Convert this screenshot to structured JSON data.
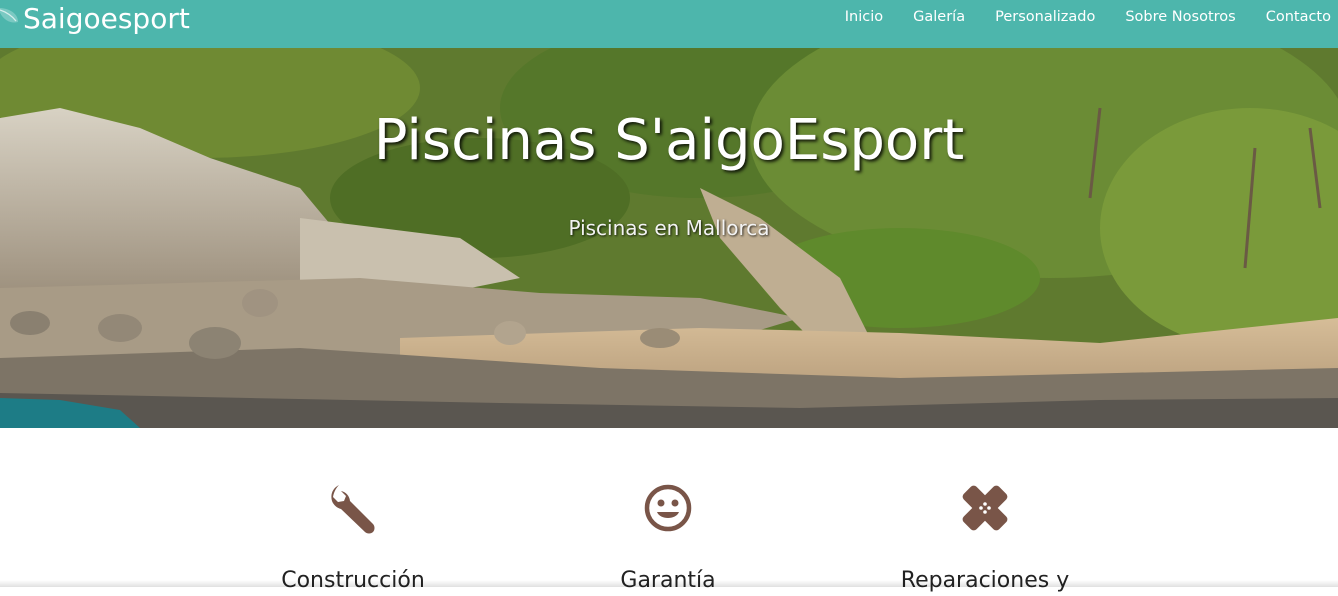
{
  "navbar": {
    "brand": "Saigoesport",
    "links": [
      "Inicio",
      "Galería",
      "Personalizado",
      "Sobre Nosotros",
      "Contacto"
    ],
    "background": "#4db6ac"
  },
  "hero": {
    "title": "Piscinas S'aigoEsport",
    "subtitle": "Piscinas en Mallorca"
  },
  "features": [
    {
      "icon": "wrench-icon",
      "title": "Construcción"
    },
    {
      "icon": "smile-icon",
      "title": "Garantía"
    },
    {
      "icon": "bandage-icon",
      "title": "Reparaciones y"
    }
  ],
  "colors": {
    "icon": "#795548",
    "text": "#222222"
  }
}
